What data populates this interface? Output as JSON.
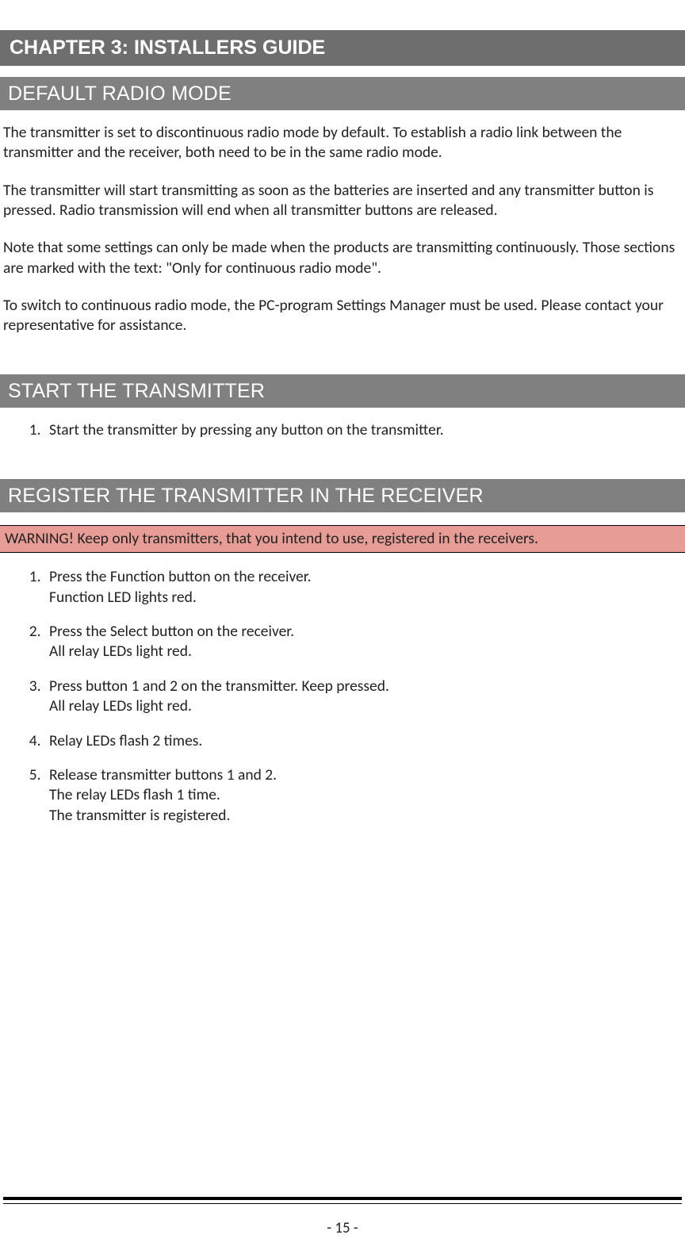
{
  "chapter": {
    "title": "CHAPTER 3: INSTALLERS GUIDE"
  },
  "sections": {
    "default_radio": {
      "title": "DEFAULT RADIO MODE",
      "p1": "The transmitter is set to discontinuous radio mode by default. To establish a radio link between the transmitter and the receiver, both need to be in the same radio mode.",
      "p2": "The transmitter will start transmitting as soon as the batteries are inserted and any transmitter button is pressed. Radio transmission will end when all transmitter buttons are released.",
      "p3": "Note that some settings can only be made when the products are transmitting continuously. Those sections are marked with the text: \"Only for continuous radio mode\".",
      "p4": "To switch to continuous radio mode, the PC-program Settings Manager must be used. Please contact your representative for assistance."
    },
    "start_transmitter": {
      "title": "START THE TRANSMITTER",
      "steps": [
        {
          "main": "Start the transmitter by pressing any button on the transmitter."
        }
      ]
    },
    "register_transmitter": {
      "title": "REGISTER THE TRANSMITTER IN THE RECEIVER",
      "warning": "WARNING! Keep only transmitters, that you intend to use, registered in the receivers.",
      "steps": [
        {
          "main": "Press the Function button on the receiver.",
          "sub1": "Function LED lights red."
        },
        {
          "main": "Press the Select button on the receiver.",
          "sub1": "All relay LEDs light red."
        },
        {
          "main": "Press button 1 and 2 on the transmitter. Keep pressed.",
          "sub1": "All relay LEDs light red."
        },
        {
          "main": "Relay LEDs flash 2 times."
        },
        {
          "main": "Release transmitter buttons 1 and 2.",
          "sub1": "The relay LEDs flash 1 time.",
          "sub2": "The transmitter is registered."
        }
      ]
    }
  },
  "footer": {
    "page_number": "- 15 -"
  }
}
